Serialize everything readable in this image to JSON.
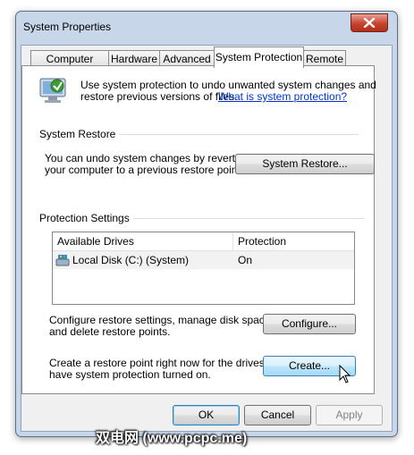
{
  "window": {
    "title": "System Properties"
  },
  "tabs": [
    {
      "label": "Computer Name"
    },
    {
      "label": "Hardware"
    },
    {
      "label": "Advanced"
    },
    {
      "label": "System Protection"
    },
    {
      "label": "Remote"
    }
  ],
  "intro": {
    "text_line1": "Use system protection to undo unwanted system changes and",
    "text_line2": "restore previous versions of files.",
    "link": "What is system protection?"
  },
  "system_restore": {
    "heading": "System Restore",
    "desc_line1": "You can undo system changes by reverting",
    "desc_line2": "your computer to a previous restore point.",
    "button": "System Restore..."
  },
  "protection": {
    "heading": "Protection Settings",
    "columns": [
      "Available Drives",
      "Protection"
    ],
    "rows": [
      {
        "drive": "Local Disk (C:) (System)",
        "protection": "On"
      }
    ],
    "configure_line1": "Configure restore settings, manage disk space,",
    "configure_line2": "and delete restore points.",
    "configure_button": "Configure...",
    "create_line1": "Create a restore point right now for the drives that",
    "create_line2": "have system protection turned on.",
    "create_button": "Create..."
  },
  "footer": {
    "ok": "OK",
    "cancel": "Cancel",
    "apply": "Apply"
  },
  "watermark": "双电网 (www.pcpc.me)",
  "colors": {
    "title_bar": "#c7d6e8",
    "link": "#0033cc",
    "close_button": "#c7432e"
  }
}
